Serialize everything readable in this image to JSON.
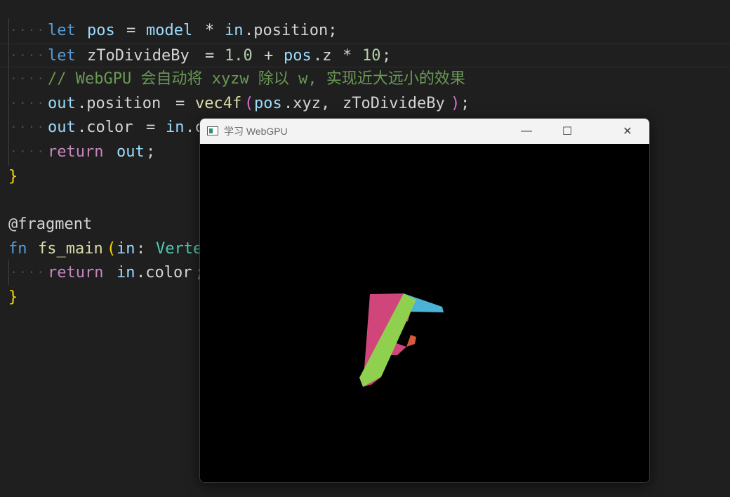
{
  "editor": {
    "lines": {
      "l1": {
        "t1": "let",
        "t2": "pos",
        "t3": "=",
        "t4": "model",
        "t5": "*",
        "t6": "in",
        "t7": ".position;"
      },
      "l2": {
        "t1": "let",
        "t2": "zToDivideBy",
        "t3": "=",
        "t4": "1.0",
        "t5": "+",
        "t6": "pos",
        "t7": ".z",
        "t8": "*",
        "t9": "10",
        "t10": ";"
      },
      "l3": {
        "comment": "// WebGPU 会自动将 xyzw 除以 w, 实现近大远小的效果"
      },
      "l4": {
        "t1": "out",
        "t2": ".position",
        "t3": "=",
        "t4": "vec4f",
        "t5": "(",
        "t6": "pos",
        "t7": ".xyz,",
        "t8": "zToDivideBy",
        "t9": ")",
        "t10": ";"
      },
      "l5": {
        "t1": "out",
        "t2": ".color",
        "t3": "=",
        "t4": "in",
        "t5": ".c"
      },
      "l6": {
        "t1": "return",
        "t2": "out",
        "t3": ";"
      },
      "l7": {
        "t1": "}"
      },
      "l9": {
        "t1": "@fragment"
      },
      "l10": {
        "t1": "fn",
        "t2": "fs_main",
        "t3": "(",
        "t4": "in",
        "t5": ":",
        "t6": "Verte"
      },
      "l11": {
        "t1": "return",
        "t2": "in",
        "t3": ".color",
        "t4": ";"
      },
      "l12": {
        "t1": "}"
      }
    },
    "whitespace_marker": "····"
  },
  "app_window": {
    "title": "学习 WebGPU",
    "controls": {
      "minimize": "—",
      "maximize": "☐",
      "close": "✕"
    }
  },
  "colors": {
    "editor_bg": "#1f1f1f",
    "face_green": "#8fd14f",
    "face_pink": "#d0457a",
    "face_cyan": "#4ab3d6",
    "face_orange": "#d45a3a"
  }
}
